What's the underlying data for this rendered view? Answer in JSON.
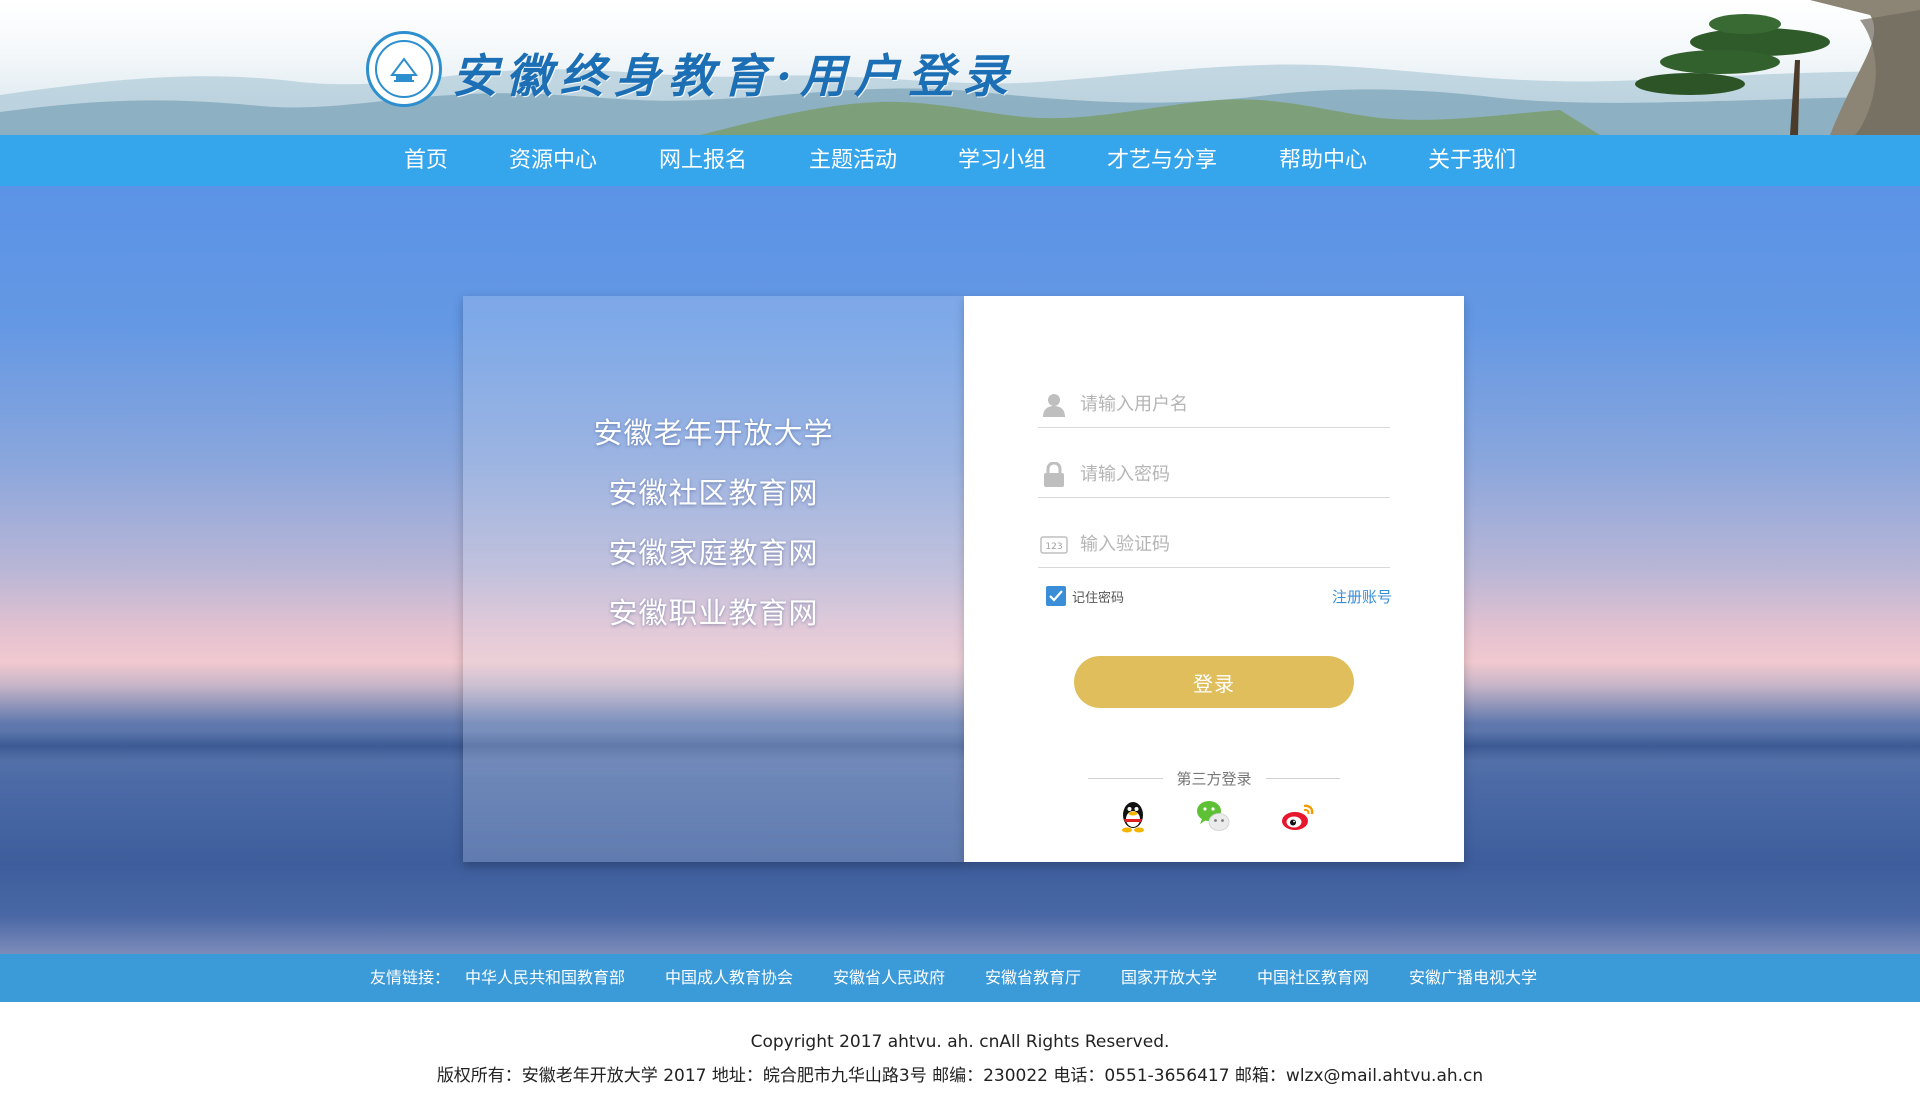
{
  "header": {
    "title": "安徽终身教育·用户登录",
    "logo": "school-seal-logo"
  },
  "nav": {
    "items": [
      "首页",
      "资源中心",
      "网上报名",
      "主题活动",
      "学习小组",
      "才艺与分享",
      "帮助中心",
      "关于我们"
    ]
  },
  "left_panel": {
    "sites": [
      "安徽老年开放大学",
      "安徽社区教育网",
      "安徽家庭教育网",
      "安徽职业教育网"
    ]
  },
  "login_form": {
    "username_placeholder": "请输入用户名",
    "password_placeholder": "请输入密码",
    "captcha_placeholder": "输入验证码",
    "remember_label": "记住密码",
    "remember_checked": true,
    "register_label": "注册账号",
    "login_button": "登录",
    "third_party_label": "第三方登录",
    "third_party_icons": [
      "qq-icon",
      "wechat-icon",
      "weibo-icon"
    ]
  },
  "friend_links": {
    "label": "友情链接：",
    "items": [
      "中华人民共和国教育部",
      "中国成人教育协会",
      "安徽省人民政府",
      "安徽省教育厅",
      "国家开放大学",
      "中国社区教育网",
      "安徽广播电视大学"
    ]
  },
  "footer": {
    "copyright": "Copyright 2017 ahtvu. ah. cnAll Rights Reserved.",
    "info": "版权所有：安徽老年开放大学 2017 地址：皖合肥市九华山路3号 邮编：230022 电话：0551-3656417 邮箱：wlzx@mail.ahtvu.ah.cn"
  },
  "colors": {
    "nav_bg": "#35a5ec",
    "links_bg": "#3b9ad8",
    "login_button": "#dfbe5b",
    "accent_blue": "#3a8ed8"
  }
}
